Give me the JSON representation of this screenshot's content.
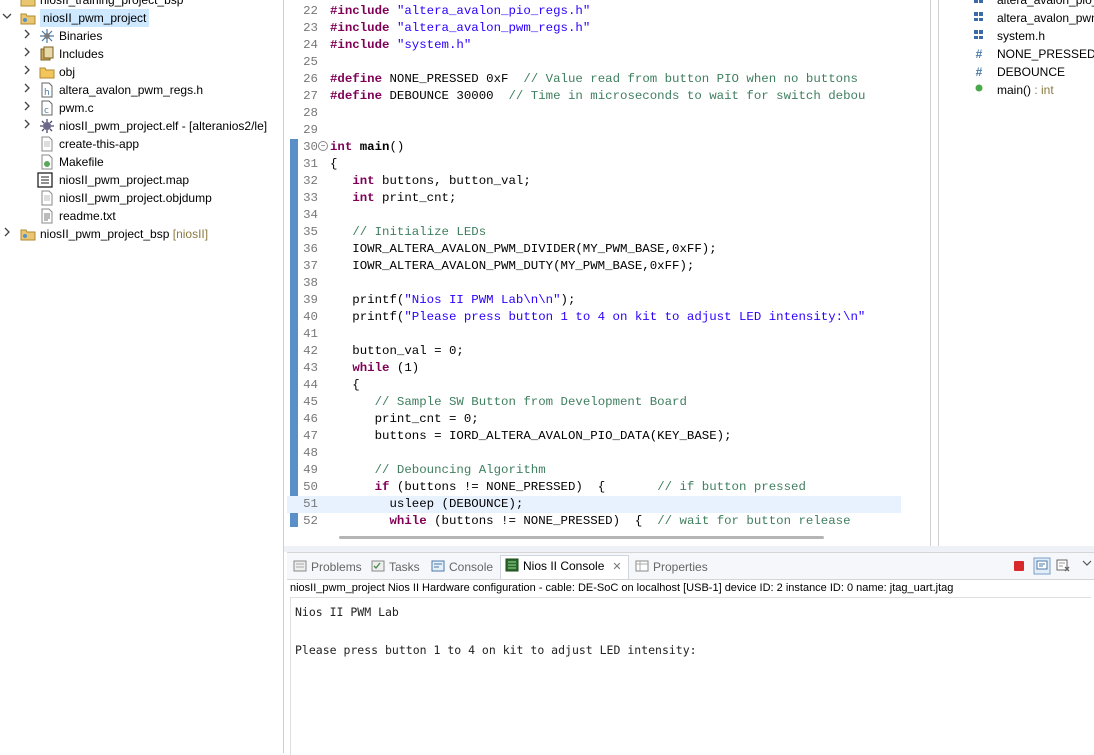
{
  "explorer": {
    "items": [
      {
        "label": "niosII_training_project_bsp",
        "icon": "folder-project-icon"
      },
      {
        "label": "niosII_pwm_project",
        "icon": "folder-project-icon",
        "chevron": "v"
      },
      {
        "label": "Binaries",
        "icon": "binaries-icon",
        "chevron": ">"
      },
      {
        "label": "Includes",
        "icon": "includes-icon",
        "chevron": ">"
      },
      {
        "label": "obj",
        "icon": "folder-icon",
        "chevron": ">"
      },
      {
        "label": "altera_avalon_pwm_regs.h",
        "icon": "header-file-icon",
        "chevron": ">"
      },
      {
        "label": "pwm.c",
        "icon": "c-file-icon",
        "chevron": ">"
      },
      {
        "label": "niosII_pwm_project.elf - [alteranios2/le]",
        "icon": "elf-file-icon",
        "chevron": ">"
      },
      {
        "label": "create-this-app",
        "icon": "file-icon"
      },
      {
        "label": "Makefile",
        "icon": "makefile-icon"
      },
      {
        "label": "niosII_pwm_project.map",
        "icon": "map-file-icon"
      },
      {
        "label": "niosII_pwm_project.objdump",
        "icon": "file-icon"
      },
      {
        "label": "readme.txt",
        "icon": "text-file-icon"
      },
      {
        "label": "niosII_pwm_project_bsp",
        "suffix": "[niosII]",
        "icon": "folder-project-icon",
        "chevron": ">"
      }
    ]
  },
  "editor": {
    "lines": [
      {
        "n": "22",
        "t": "#include \"altera_avalon_pio_regs.h\""
      },
      {
        "n": "23",
        "t": "#include \"altera_avalon_pwm_regs.h\""
      },
      {
        "n": "24",
        "t": "#include \"system.h\""
      },
      {
        "n": "25",
        "t": ""
      },
      {
        "n": "26",
        "t": "#define NONE_PRESSED 0xF  // Value read from button PIO when no buttons"
      },
      {
        "n": "27",
        "t": "#define DEBOUNCE 30000  // Time in microseconds to wait for switch debou"
      },
      {
        "n": "28",
        "t": ""
      },
      {
        "n": "29",
        "t": ""
      },
      {
        "n": "30",
        "t": "int main()"
      },
      {
        "n": "31",
        "t": "{"
      },
      {
        "n": "32",
        "t": "   int buttons, button_val;"
      },
      {
        "n": "33",
        "t": "   int print_cnt;"
      },
      {
        "n": "34",
        "t": ""
      },
      {
        "n": "35",
        "t": "   // Initialize LEDs"
      },
      {
        "n": "36",
        "t": "   IOWR_ALTERA_AVALON_PWM_DIVIDER(MY_PWM_BASE,0xFF);"
      },
      {
        "n": "37",
        "t": "   IOWR_ALTERA_AVALON_PWM_DUTY(MY_PWM_BASE,0xFF);"
      },
      {
        "n": "38",
        "t": ""
      },
      {
        "n": "39",
        "t": "   printf(\"Nios II PWM Lab\\n\\n\");"
      },
      {
        "n": "40",
        "t": "   printf(\"Please press button 1 to 4 on kit to adjust LED intensity:\\n\""
      },
      {
        "n": "41",
        "t": ""
      },
      {
        "n": "42",
        "t": "   button_val = 0;"
      },
      {
        "n": "43",
        "t": "   while (1)"
      },
      {
        "n": "44",
        "t": "   {"
      },
      {
        "n": "45",
        "t": "      // Sample SW Button from Development Board"
      },
      {
        "n": "46",
        "t": "      print_cnt = 0;"
      },
      {
        "n": "47",
        "t": "      buttons = IORD_ALTERA_AVALON_PIO_DATA(KEY_BASE);"
      },
      {
        "n": "48",
        "t": ""
      },
      {
        "n": "49",
        "t": "      // Debouncing Algorithm"
      },
      {
        "n": "50",
        "t": "      if (buttons != NONE_PRESSED)  {       // if button pressed"
      },
      {
        "n": "51",
        "t": "        usleep (DEBOUNCE);"
      },
      {
        "n": "52",
        "t": "        while (buttons != NONE_PRESSED)  {  // wait for button release"
      }
    ]
  },
  "outline": {
    "items": [
      {
        "label": "altera_avalon_pio_r",
        "icon": "include-icon"
      },
      {
        "label": "altera_avalon_pwm",
        "icon": "include-icon"
      },
      {
        "label": "system.h",
        "icon": "include-icon"
      },
      {
        "label": "NONE_PRESSED",
        "icon": "macro-icon"
      },
      {
        "label": "DEBOUNCE",
        "icon": "macro-icon"
      },
      {
        "label": "main()",
        "type": " : int",
        "icon": "function-icon"
      }
    ]
  },
  "console": {
    "tabs": [
      {
        "label": "Problems",
        "icon": "problems-icon"
      },
      {
        "label": "Tasks",
        "icon": "tasks-icon"
      },
      {
        "label": "Console",
        "icon": "console-icon"
      },
      {
        "label": "Nios II Console",
        "icon": "nios-console-icon",
        "active": true
      },
      {
        "label": "Properties",
        "icon": "properties-icon"
      }
    ],
    "description": "niosII_pwm_project Nios II Hardware configuration - cable: DE-SoC on localhost [USB-1] device ID: 2 instance ID: 0 name: jtag_uart.jtag",
    "output": [
      "Nios II PWM Lab",
      "",
      "Please press button 1 to 4 on kit to adjust LED intensity:"
    ],
    "toolbar": [
      "terminate-icon",
      "pin-console-icon",
      "clear-console-icon",
      "view-menu-icon"
    ]
  }
}
